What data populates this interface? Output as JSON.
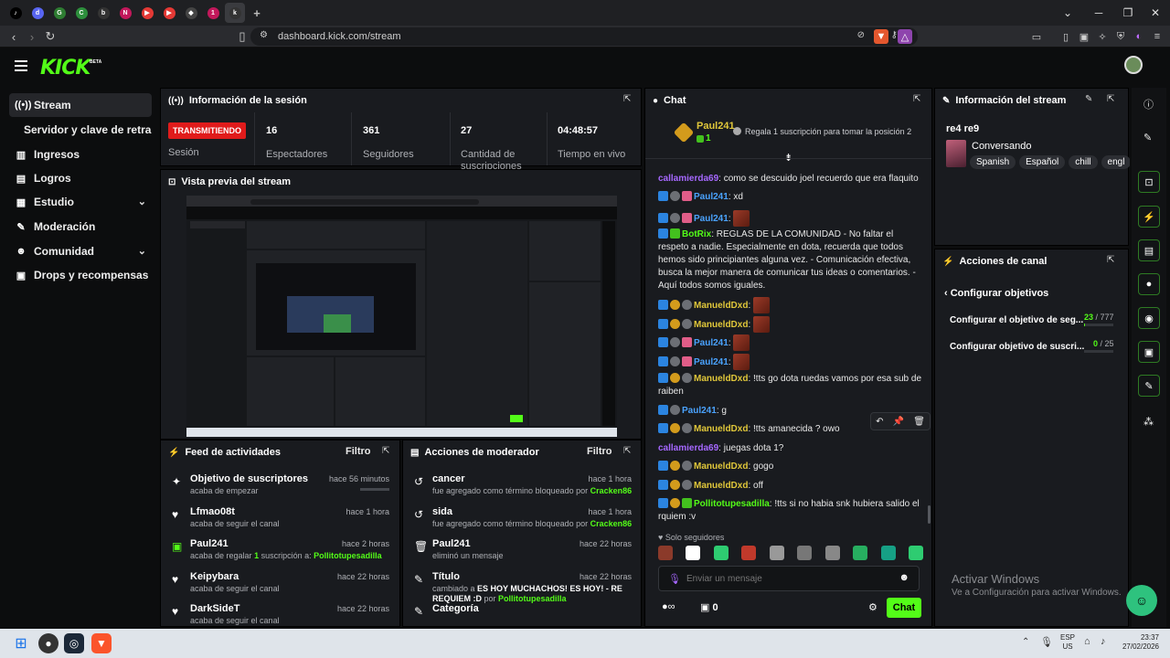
{
  "browser": {
    "url": "dashboard.kick.com/stream",
    "new_tab_symbol": "+",
    "tabs": [
      {
        "icon": "tiktok-icon",
        "color": "#000000",
        "glyph": "♪"
      },
      {
        "icon": "discord-icon",
        "color": "#5865f2",
        "glyph": "d"
      },
      {
        "icon": "app-icon",
        "color": "#2e7d32",
        "glyph": "G"
      },
      {
        "icon": "chrome-icon",
        "color": "#2d8f3c",
        "glyph": "C"
      },
      {
        "icon": "app-icon",
        "color": "#333333",
        "glyph": "b"
      },
      {
        "icon": "notion-icon",
        "color": "#c2185b",
        "glyph": "N"
      },
      {
        "icon": "youtube-icon",
        "color": "#e53935",
        "glyph": "▶"
      },
      {
        "icon": "youtube-icon",
        "color": "#e53935",
        "glyph": "▶"
      },
      {
        "icon": "app-icon",
        "color": "#444444",
        "glyph": "◆"
      },
      {
        "icon": "app-icon",
        "color": "#c2185b",
        "glyph": "1"
      },
      {
        "icon": "kick-icon",
        "color": "#333333",
        "glyph": "k"
      }
    ]
  },
  "header": {
    "logo": "KICK",
    "beta": "BETA"
  },
  "sidebar": {
    "items": [
      {
        "label": "Stream",
        "icon": "stream-icon",
        "glyph": "((•))",
        "active": true
      },
      {
        "label": "Servidor y clave de retransmisión",
        "icon": "",
        "glyph": "",
        "sub": true
      },
      {
        "label": "Ingresos",
        "icon": "chart-icon",
        "glyph": "▥"
      },
      {
        "label": "Logros",
        "icon": "chart-icon",
        "glyph": "▤"
      },
      {
        "label": "Estudio",
        "icon": "grid-icon",
        "glyph": "▦",
        "chevron": "⌄"
      },
      {
        "label": "Moderación",
        "icon": "wrench-icon",
        "glyph": "✎"
      },
      {
        "label": "Comunidad",
        "icon": "people-icon",
        "glyph": "☻",
        "chevron": "⌄"
      },
      {
        "label": "Drops y recompensas",
        "icon": "gift-icon",
        "glyph": "▣"
      }
    ]
  },
  "session": {
    "title": "Información de la sesión",
    "live_badge": "TRANSMITIENDO",
    "session_label": "Sesión",
    "stats": [
      {
        "value": "16",
        "label": "Espectadores"
      },
      {
        "value": "361",
        "label": "Seguidores"
      },
      {
        "value": "27",
        "label": "Cantidad de suscripciones"
      },
      {
        "value": "04:48:57",
        "label": "Tiempo en vivo"
      }
    ]
  },
  "preview": {
    "title": "Vista previa del stream"
  },
  "feed": {
    "title": "Feed de actividades",
    "filter": "Filtro",
    "items": [
      {
        "icon": "star-icon",
        "glyph": "✦",
        "title": "Objetivo de suscriptores",
        "sub": "acaba de empezar",
        "time": "hace 56 minutos"
      },
      {
        "icon": "heart-icon",
        "glyph": "♥",
        "title": "Lfmao08t",
        "sub": "acaba de seguir el canal",
        "time": "hace 1 hora"
      },
      {
        "icon": "gift-icon",
        "glyph": "▣",
        "title": "Paul241",
        "sub_prefix": "acaba de regalar ",
        "sub_count": "1",
        "sub_mid": " suscripción a: ",
        "sub_user": "Pollitotupesadilla",
        "time": "hace 2 horas"
      },
      {
        "icon": "heart-icon",
        "glyph": "♥",
        "title": "Keipybara",
        "sub": "acaba de seguir el canal",
        "time": "hace 22 horas"
      },
      {
        "icon": "heart-icon",
        "glyph": "♥",
        "title": "DarkSideT",
        "sub": "acaba de seguir el canal",
        "time": "hace 22 horas"
      }
    ]
  },
  "modactions": {
    "title": "Acciones de moderador",
    "filter": "Filtro",
    "items": [
      {
        "icon": "undo-icon",
        "glyph": "↺",
        "title": "cancer",
        "sub": "fue agregado como término bloqueado por ",
        "by": "Cracken86",
        "time": "hace 1 hora"
      },
      {
        "icon": "undo-icon",
        "glyph": "↺",
        "title": "sida",
        "sub": "fue agregado como término bloqueado por ",
        "by": "Cracken86",
        "time": "hace 1 hora"
      },
      {
        "icon": "trash-icon",
        "glyph": "🗑",
        "title": "Paul241",
        "sub": "eliminó un mensaje",
        "by": "",
        "time": "hace 22 horas"
      },
      {
        "icon": "pencil-icon",
        "glyph": "✎",
        "title": "Título",
        "sub": "cambiado a ",
        "bold": "ES HOY MUCHACHOS! ES HOY! - RE REQUIEM :D",
        "sub2": " por ",
        "by": "Pollitotupesadilla",
        "time": "hace 22 horas"
      },
      {
        "icon": "pencil-icon",
        "glyph": "✎",
        "title": "Categoría",
        "sub": "",
        "by": "",
        "time": ""
      }
    ]
  },
  "chat": {
    "title": "Chat",
    "pinned_user": "Paul241",
    "pinned_count": "1",
    "pinned_text": "Regala 1 suscripción para tomar la posición 2",
    "followers_only": "Solo seguidores",
    "input_placeholder": "Enviar un mensaje",
    "send": "Chat",
    "points": "0",
    "messages": [
      {
        "user": "callamierda69",
        "color": "purple",
        "badges": [],
        "text": ": como se descuido joel recuerdo que era flaquito"
      },
      {
        "user": "Paul241",
        "color": "blue",
        "badges": [
          "blue",
          "gray",
          "pink"
        ],
        "text": ": xd"
      },
      {
        "user": "Paul241",
        "color": "blue",
        "badges": [
          "blue",
          "gray",
          "pink"
        ],
        "text": ": ",
        "emote": true
      },
      {
        "user": "BotRix",
        "color": "green",
        "badges": [
          "blue",
          "green"
        ],
        "text": ": REGLAS DE LA COMUNIDAD - No faltar el respeto a nadie. Especialmente en dota, recuerda que todos hemos sido principiantes alguna vez. - Comunicación efectiva, busca la mejor manera de comunicar tus ideas o comentarios. - Aquí todos somos iguales."
      },
      {
        "user": "ManueldDxd",
        "color": "yellow",
        "badges": [
          "blue",
          "gold",
          "gray"
        ],
        "text": ": ",
        "emote": true
      },
      {
        "user": "ManueldDxd",
        "color": "yellow",
        "badges": [
          "blue",
          "gold",
          "gray"
        ],
        "text": ": ",
        "emote": true
      },
      {
        "user": "Paul241",
        "color": "blue",
        "badges": [
          "blue",
          "gray",
          "pink"
        ],
        "text": ": ",
        "emote": true
      },
      {
        "user": "Paul241",
        "color": "blue",
        "badges": [
          "blue",
          "gray",
          "pink"
        ],
        "text": ": ",
        "emote": true
      },
      {
        "user": "ManueldDxd",
        "color": "yellow",
        "badges": [
          "blue",
          "gold",
          "gray"
        ],
        "text": ": !tts go dota ruedas vamos por esa sub de raiben"
      },
      {
        "user": "Paul241",
        "color": "blue",
        "badges": [
          "blue",
          "gray"
        ],
        "text": ": g"
      },
      {
        "user": "ManueldDxd",
        "color": "yellow",
        "badges": [
          "blue",
          "gold",
          "gray"
        ],
        "text": ": !tts amanecida ? owo"
      },
      {
        "user": "callamierda69",
        "color": "purple",
        "badges": [],
        "text": ": juegas dota 1?"
      },
      {
        "user": "ManueldDxd",
        "color": "yellow",
        "badges": [
          "blue",
          "gold",
          "gray"
        ],
        "text": ": gogo"
      },
      {
        "user": "ManueldDxd",
        "color": "yellow",
        "badges": [
          "blue",
          "gold",
          "gray"
        ],
        "text": ": off"
      },
      {
        "user": "Pollitotupesadilla",
        "color": "green",
        "badges": [
          "blue",
          "gold",
          "green"
        ],
        "text": ": !tts si no habia snk hubiera salido el rquiem :v"
      }
    ]
  },
  "streaminfo": {
    "title": "Información del stream",
    "stream_title": "re4 re9",
    "category": "Conversando",
    "tags": [
      "Spanish",
      "Español",
      "chill",
      "engl"
    ]
  },
  "channelactions": {
    "title": "Acciones de canal",
    "back_label": "Configurar objetivos",
    "goals": [
      {
        "label": "Configurar el objetivo de seg...",
        "current": "23",
        "total": "/ 777",
        "progress": 0.03
      },
      {
        "label": "Configurar objetivo de suscri...",
        "current": "0",
        "total": "/ 25",
        "progress": 0.0
      }
    ]
  },
  "watermark": {
    "line1": "Activar Windows",
    "line2": "Ve a Configuración para activar Windows."
  },
  "taskbar": {
    "lang1": "ESP",
    "lang2": "US",
    "time": "23:37",
    "date": "27/02/2026"
  }
}
